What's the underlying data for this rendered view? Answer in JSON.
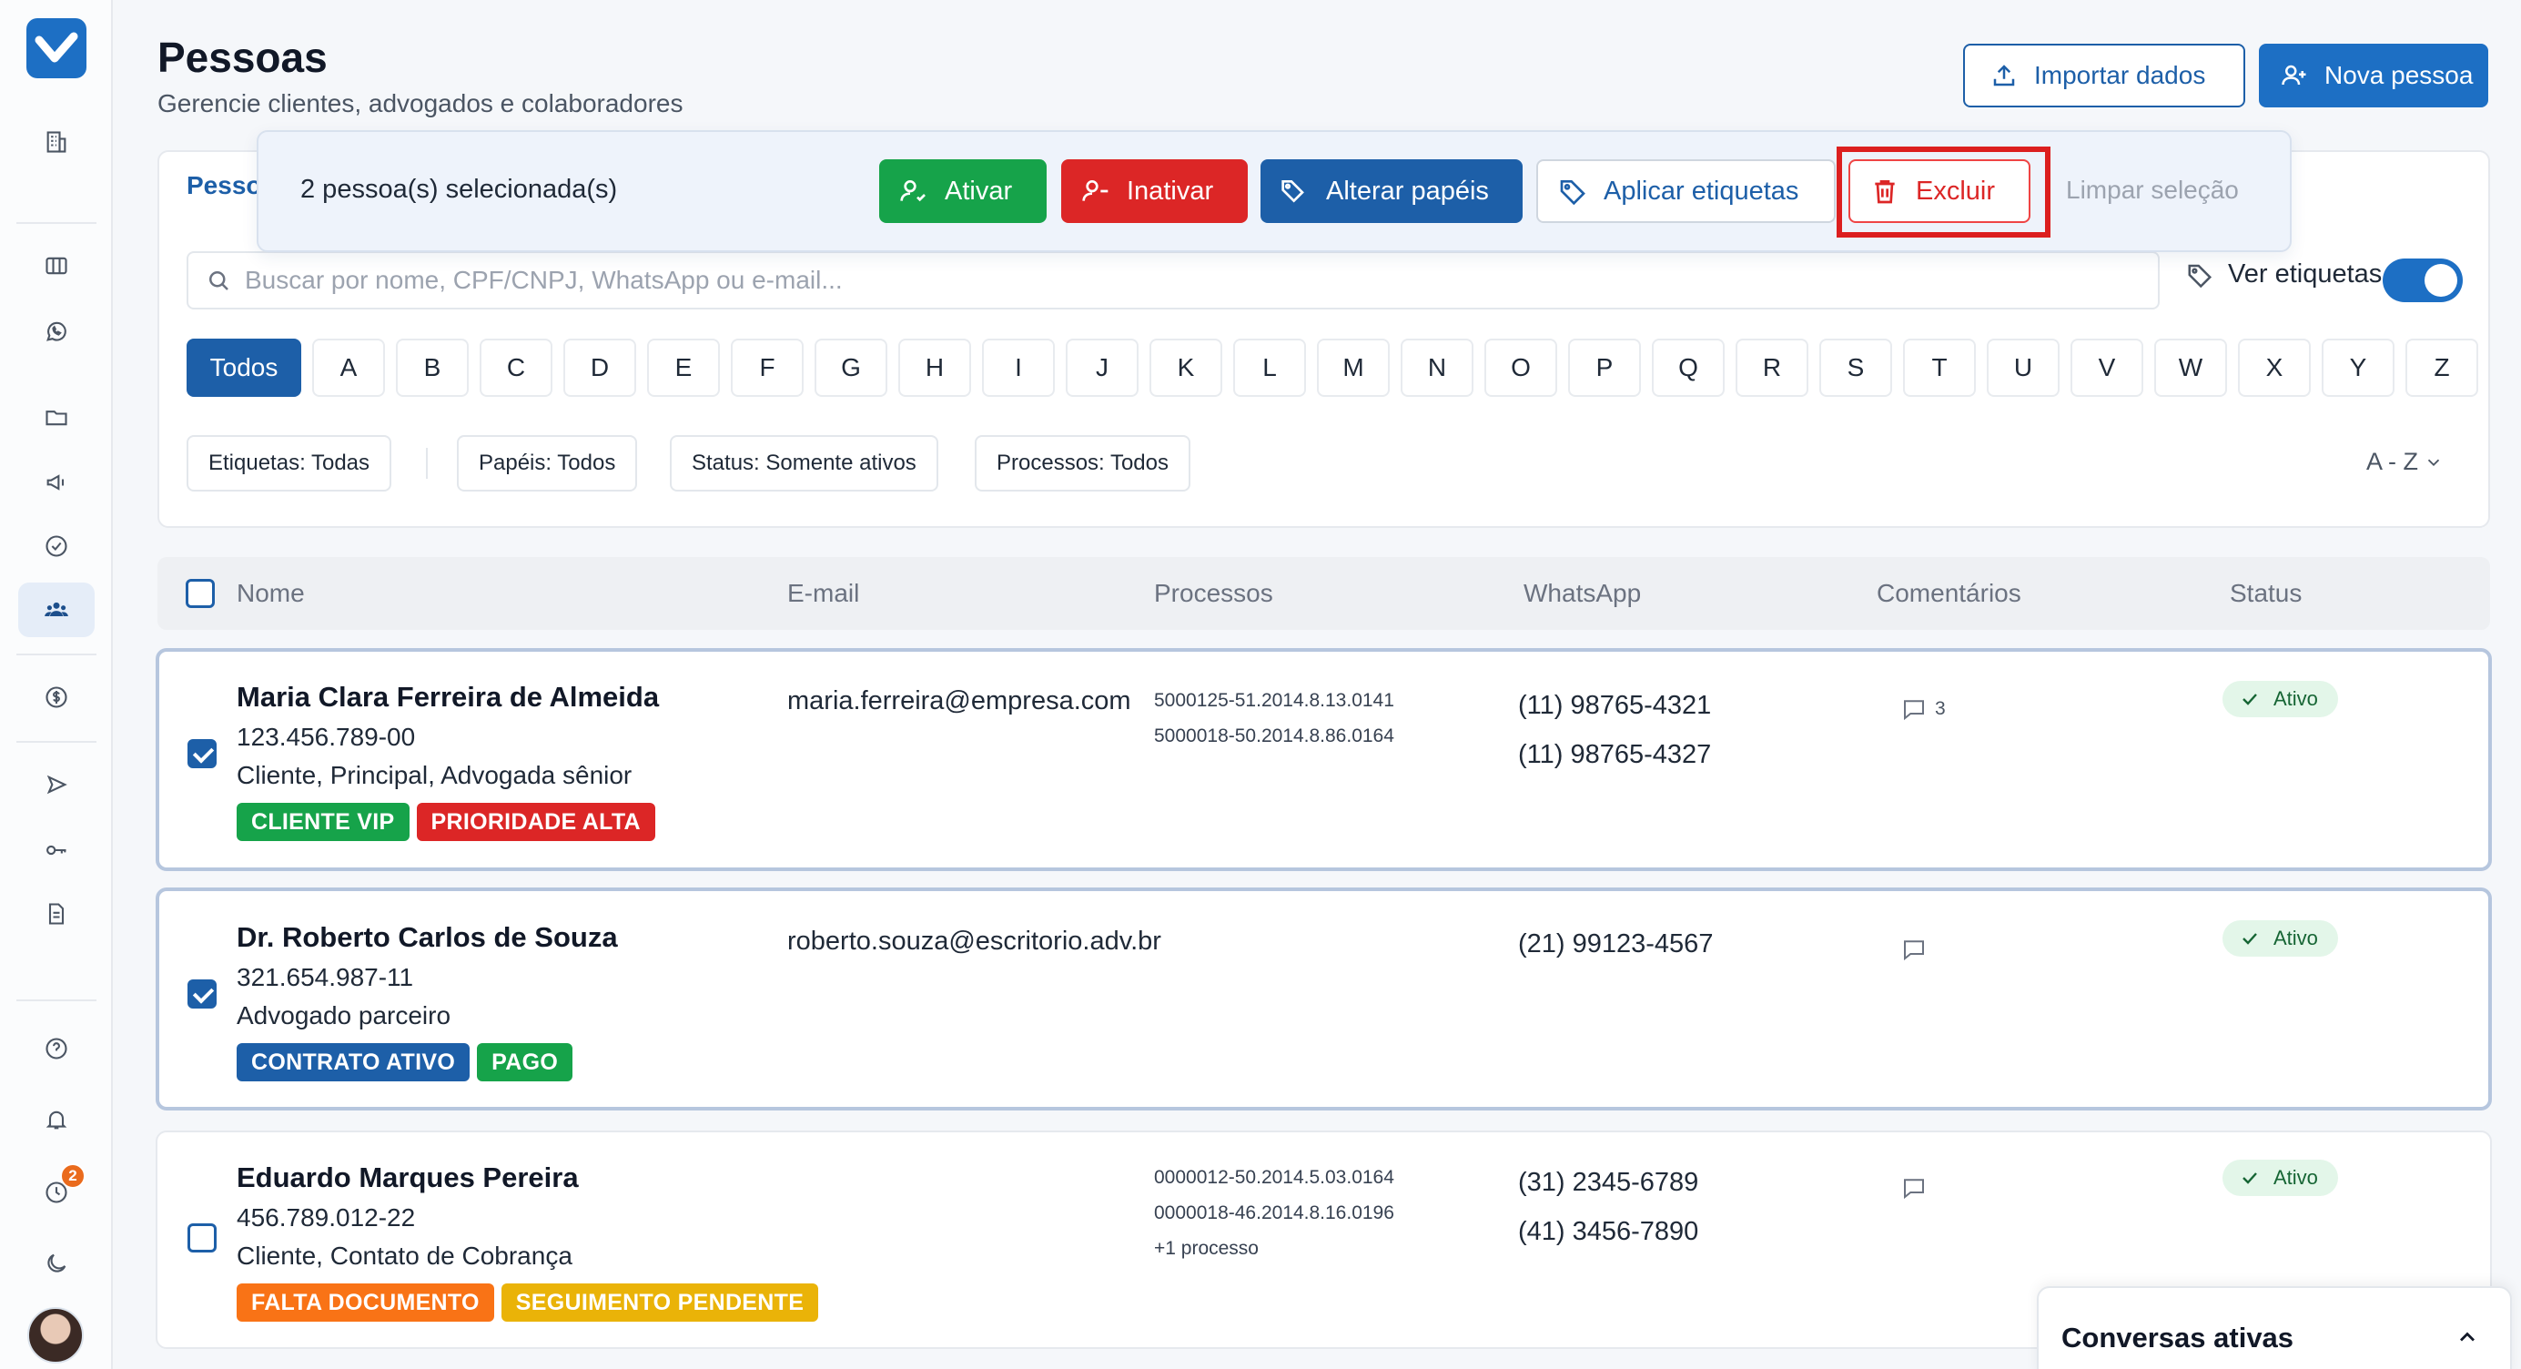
{
  "header": {
    "title": "Pessoas",
    "subtitle": "Gerencie clientes, advogados e colaboradores",
    "import_label": "Importar dados",
    "new_label": "Nova pessoa"
  },
  "tabs": {
    "people": "Pesso"
  },
  "selection_bar": {
    "count": "2 pessoa(s) selecionada(s)",
    "activate": "Ativar",
    "deactivate": "Inativar",
    "change_roles": "Alterar papéis",
    "apply_tags": "Aplicar etiquetas",
    "delete": "Excluir",
    "clear": "Limpar seleção"
  },
  "search": {
    "placeholder": "Buscar por nome, CPF/CNPJ, WhatsApp ou e-mail..."
  },
  "tags_toggle": {
    "label": "Ver etiquetas",
    "on": true
  },
  "alphabet": {
    "all": "Todos",
    "letters": [
      "A",
      "B",
      "C",
      "D",
      "E",
      "F",
      "G",
      "H",
      "I",
      "J",
      "K",
      "L",
      "M",
      "N",
      "O",
      "P",
      "Q",
      "R",
      "S",
      "T",
      "U",
      "V",
      "W",
      "X",
      "Y",
      "Z"
    ]
  },
  "filters": {
    "tags": "Etiquetas: Todas",
    "roles": "Papéis: Todos",
    "status": "Status: Somente ativos",
    "processes": "Processos: Todos",
    "sort": "A - Z"
  },
  "table": {
    "columns": [
      "Nome",
      "E-mail",
      "Processos",
      "WhatsApp",
      "Comentários",
      "Status"
    ],
    "rows": [
      {
        "selected": true,
        "name": "Maria Clara Ferreira de Almeida",
        "doc": "123.456.789-00",
        "roles": "Cliente, Principal, Advogada sênior",
        "tags": [
          {
            "label": "CLIENTE VIP",
            "color": "#16a34a"
          },
          {
            "label": "PRIORIDADE ALTA",
            "color": "#dc2626"
          }
        ],
        "email": "maria.ferreira@empresa.com",
        "processes": [
          "5000125-51.2014.8.13.0141",
          "5000018-50.2014.8.86.0164"
        ],
        "whatsapp": [
          "(11) 98765-4321",
          "(11) 98765-4327"
        ],
        "comments": "3",
        "status": "Ativo"
      },
      {
        "selected": true,
        "name": "Dr. Roberto Carlos de Souza",
        "doc": "321.654.987-11",
        "roles": "Advogado parceiro",
        "tags": [
          {
            "label": "CONTRATO ATIVO",
            "color": "#1d5fa8"
          },
          {
            "label": "PAGO",
            "color": "#16a34a"
          }
        ],
        "email": "roberto.souza@escritorio.adv.br",
        "processes": [],
        "whatsapp": [
          "(21) 99123-4567"
        ],
        "comments": "",
        "status": "Ativo"
      },
      {
        "selected": false,
        "name": "Eduardo Marques Pereira",
        "doc": "456.789.012-22",
        "roles": "Cliente, Contato de Cobrança",
        "tags": [
          {
            "label": "FALTA DOCUMENTO",
            "color": "#f97316"
          },
          {
            "label": "SEGUIMENTO PENDENTE",
            "color": "#eab308"
          }
        ],
        "email": "",
        "processes": [
          "0000012-50.2014.5.03.0164",
          "0000018-46.2014.8.16.0196",
          "+1 processo"
        ],
        "whatsapp": [
          "(31) 2345-6789",
          "(41) 3456-7890"
        ],
        "comments": "",
        "status": "Ativo"
      }
    ]
  },
  "notifications_badge": "2",
  "chat": {
    "title": "Conversas ativas"
  },
  "colors": {
    "primary": "#1d5fa8",
    "success": "#16a34a",
    "danger": "#dc2626",
    "highlight": "#dc1f1f"
  }
}
